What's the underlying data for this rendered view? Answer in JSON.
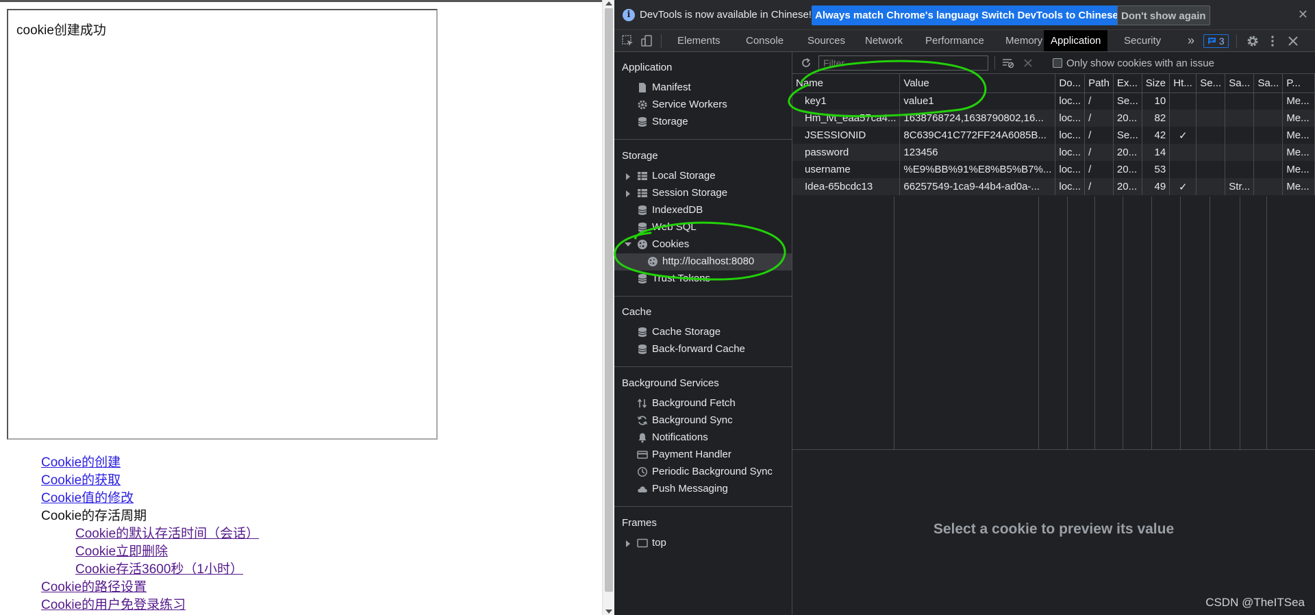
{
  "page": {
    "iframe_message": "cookie创建成功",
    "links": [
      {
        "label": "Cookie的创建",
        "kind": "link"
      },
      {
        "label": "Cookie的获取",
        "kind": "link"
      },
      {
        "label": "Cookie值的修改",
        "kind": "link"
      },
      {
        "label": "Cookie的存活周期",
        "kind": "plain"
      },
      {
        "label": "Cookie的默认存活时间（会话）",
        "kind": "sublink"
      },
      {
        "label": "Cookie立即删除",
        "kind": "sublink"
      },
      {
        "label": "Cookie存活3600秒（1小时）",
        "kind": "sublink"
      },
      {
        "label": "Cookie的路径设置",
        "kind": "link"
      },
      {
        "label": "Cookie的用户免登录练习",
        "kind": "link"
      }
    ]
  },
  "devtools": {
    "infobar": {
      "message": "DevTools is now available in Chinese!",
      "btn_match": "Always match Chrome's language",
      "btn_switch": "Switch DevTools to Chinese",
      "btn_dismiss": "Don't show again",
      "close": "✕"
    },
    "tabs": [
      "Elements",
      "Console",
      "Sources",
      "Network",
      "Performance",
      "Memory",
      "Application",
      "Security"
    ],
    "active_tab": "Application",
    "more_tabs": "»",
    "issues_count": "3",
    "sidebar": {
      "application_title": "Application",
      "application_items": [
        "Manifest",
        "Service Workers",
        "Storage"
      ],
      "storage_title": "Storage",
      "storage_items": [
        "Local Storage",
        "Session Storage",
        "IndexedDB",
        "Web SQL",
        "Cookies",
        "http://localhost:8080",
        "Trust Tokens"
      ],
      "cache_title": "Cache",
      "cache_items": [
        "Cache Storage",
        "Back-forward Cache"
      ],
      "bg_title": "Background Services",
      "bg_items": [
        "Background Fetch",
        "Background Sync",
        "Notifications",
        "Payment Handler",
        "Periodic Background Sync",
        "Push Messaging"
      ],
      "frames_title": "Frames",
      "frames_items": [
        "top"
      ]
    },
    "cookies": {
      "filter_placeholder": "Filter",
      "only_issues_label": "Only show cookies with an issue",
      "columns": [
        "Name",
        "Value",
        "Do...",
        "Path",
        "Ex...",
        "Size",
        "Ht...",
        "Se...",
        "Sa...",
        "Sa...",
        "P..."
      ],
      "rows": [
        [
          "key1",
          "value1",
          "loc...",
          "/",
          "Se...",
          "10",
          "",
          "",
          "",
          "",
          "Me..."
        ],
        [
          "Hm_lvt_eaa57ca4...",
          "1638768724,1638790802,16...",
          "loc...",
          "/",
          "20...",
          "82",
          "",
          "",
          "",
          "",
          "Me..."
        ],
        [
          "JSESSIONID",
          "8C639C41C772FF24A6085B...",
          "loc...",
          "/",
          "Se...",
          "42",
          "✓",
          "",
          "",
          "",
          "Me..."
        ],
        [
          "password",
          "123456",
          "loc...",
          "/",
          "20...",
          "14",
          "",
          "",
          "",
          "",
          "Me..."
        ],
        [
          "username",
          "%E9%BB%91%E8%B5%B7%...",
          "loc...",
          "/",
          "20...",
          "53",
          "",
          "",
          "",
          "",
          "Me..."
        ],
        [
          "Idea-65bcdc13",
          "66257549-1ca9-44b4-ad0a-...",
          "loc...",
          "/",
          "20...",
          "49",
          "✓",
          "",
          "Str...",
          "",
          "Me..."
        ]
      ],
      "preview_text": "Select a cookie to preview its value"
    },
    "watermark": "CSDN @TheITSea"
  },
  "colors": {
    "annotation": "#22d10a",
    "link": "#2a1ee0",
    "accent": "#1a73e8"
  }
}
